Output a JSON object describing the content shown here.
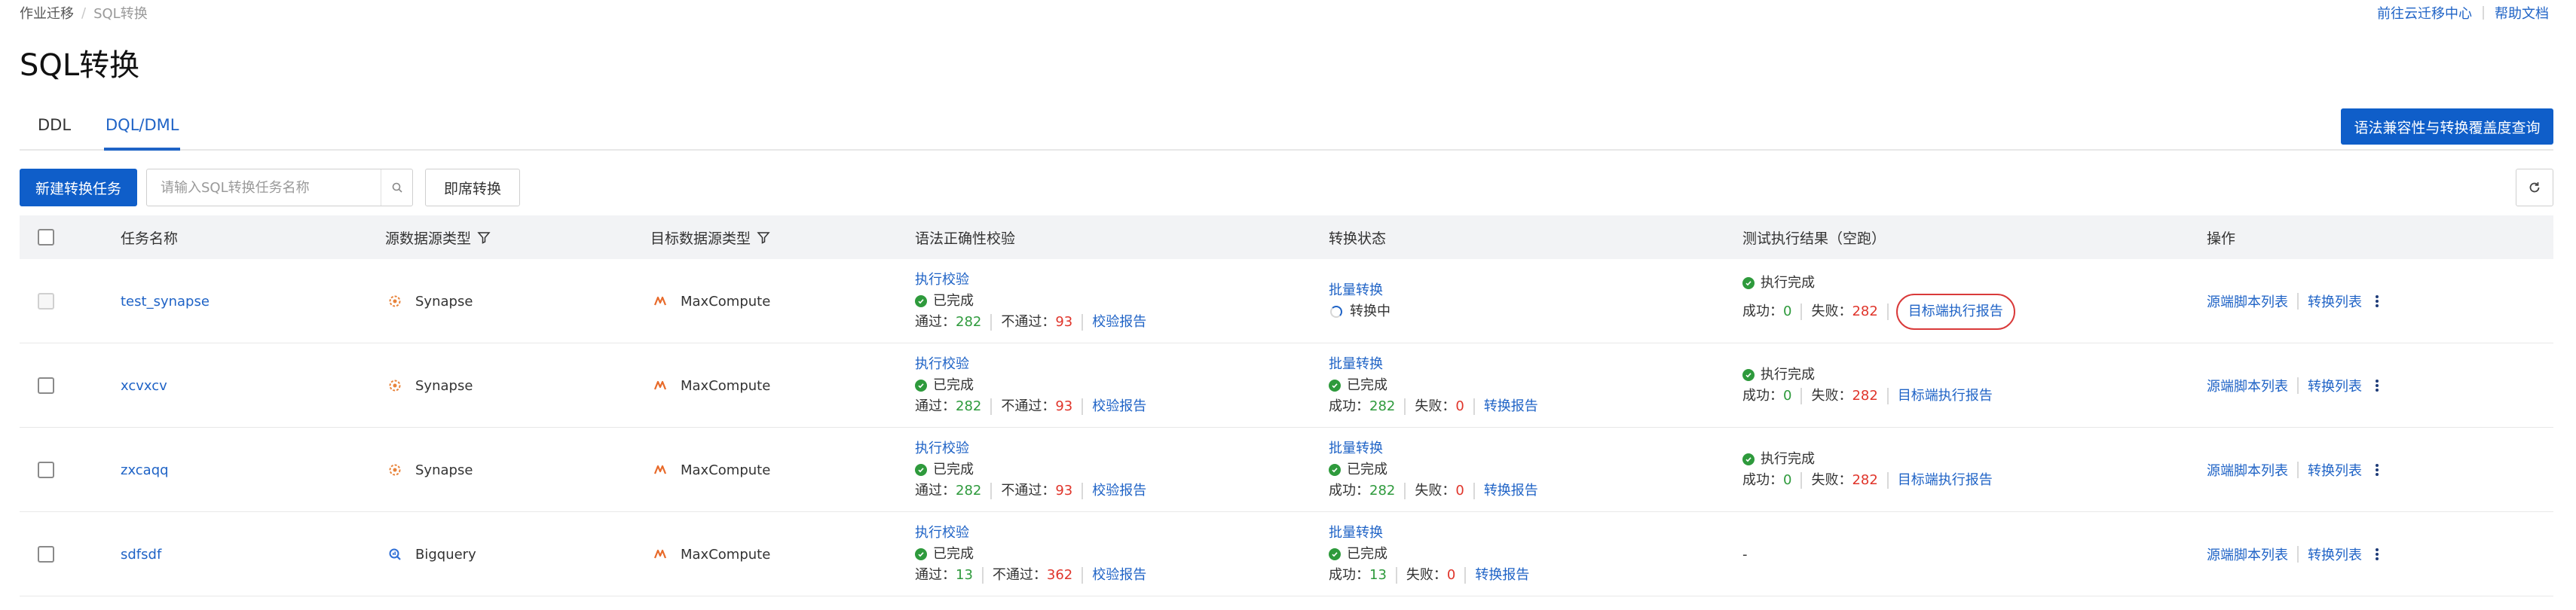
{
  "breadcrumb": {
    "parent": "作业迁移",
    "separator": "/",
    "current": "SQL转换"
  },
  "top_links": {
    "migration_center": "前往云迁移中心",
    "help": "帮助文档"
  },
  "page_title": "SQL转换",
  "tabs": [
    {
      "label": "DDL",
      "active": false
    },
    {
      "label": "DQL/DML",
      "active": true
    }
  ],
  "compat_button": "语法兼容性与转换覆盖度查询",
  "toolbar": {
    "new_task": "新建转换任务",
    "search_placeholder": "请输入SQL转换任务名称",
    "instant_convert": "即席转换"
  },
  "columns": {
    "name": "任务名称",
    "source_type": "源数据源类型",
    "target_type": "目标数据源类型",
    "syntax_check": "语法正确性校验",
    "convert_status": "转换状态",
    "test_result": "测试执行结果（空跑）",
    "actions": "操作"
  },
  "labels": {
    "run_check": "执行校验",
    "completed": "已完成",
    "passed": "通过：",
    "failed_check": "不通过：",
    "check_report": "校验报告",
    "batch_convert": "批量转换",
    "converting": "转换中",
    "success": "成功：",
    "failed": "失败：",
    "convert_report": "转换报告",
    "exec_done": "执行完成",
    "target_exec_report": "目标端执行报告",
    "source_scripts": "源端脚本列表",
    "convert_list": "转换列表"
  },
  "rows": [
    {
      "name": "test_synapse",
      "source": "Synapse",
      "source_icon": "synapse-icon",
      "target": "MaxCompute",
      "target_icon": "maxcompute-icon",
      "check_pass": "282",
      "check_fail": "93",
      "converting": true,
      "conv_success": "",
      "conv_fail": "",
      "has_test": true,
      "test_success": "0",
      "test_fail": "282",
      "test_empty": ""
    },
    {
      "name": "xcvxcv",
      "source": "Synapse",
      "source_icon": "synapse-icon",
      "target": "MaxCompute",
      "target_icon": "maxcompute-icon",
      "check_pass": "282",
      "check_fail": "93",
      "converting": false,
      "conv_success": "282",
      "conv_fail": "0",
      "has_test": true,
      "test_success": "0",
      "test_fail": "282",
      "test_empty": ""
    },
    {
      "name": "zxcaqq",
      "source": "Synapse",
      "source_icon": "synapse-icon",
      "target": "MaxCompute",
      "target_icon": "maxcompute-icon",
      "check_pass": "282",
      "check_fail": "93",
      "converting": false,
      "conv_success": "282",
      "conv_fail": "0",
      "has_test": true,
      "test_success": "0",
      "test_fail": "282",
      "test_empty": ""
    },
    {
      "name": "sdfsdf",
      "source": "Bigquery",
      "source_icon": "bigquery-icon",
      "target": "MaxCompute",
      "target_icon": "maxcompute-icon",
      "check_pass": "13",
      "check_fail": "362",
      "converting": false,
      "conv_success": "13",
      "conv_fail": "0",
      "has_test": false,
      "test_success": "",
      "test_fail": "",
      "test_empty": "-"
    }
  ],
  "colors": {
    "primary": "#0f5ec9",
    "link": "#1f63c6",
    "success": "#2e9a3c",
    "danger": "#e0352b"
  }
}
